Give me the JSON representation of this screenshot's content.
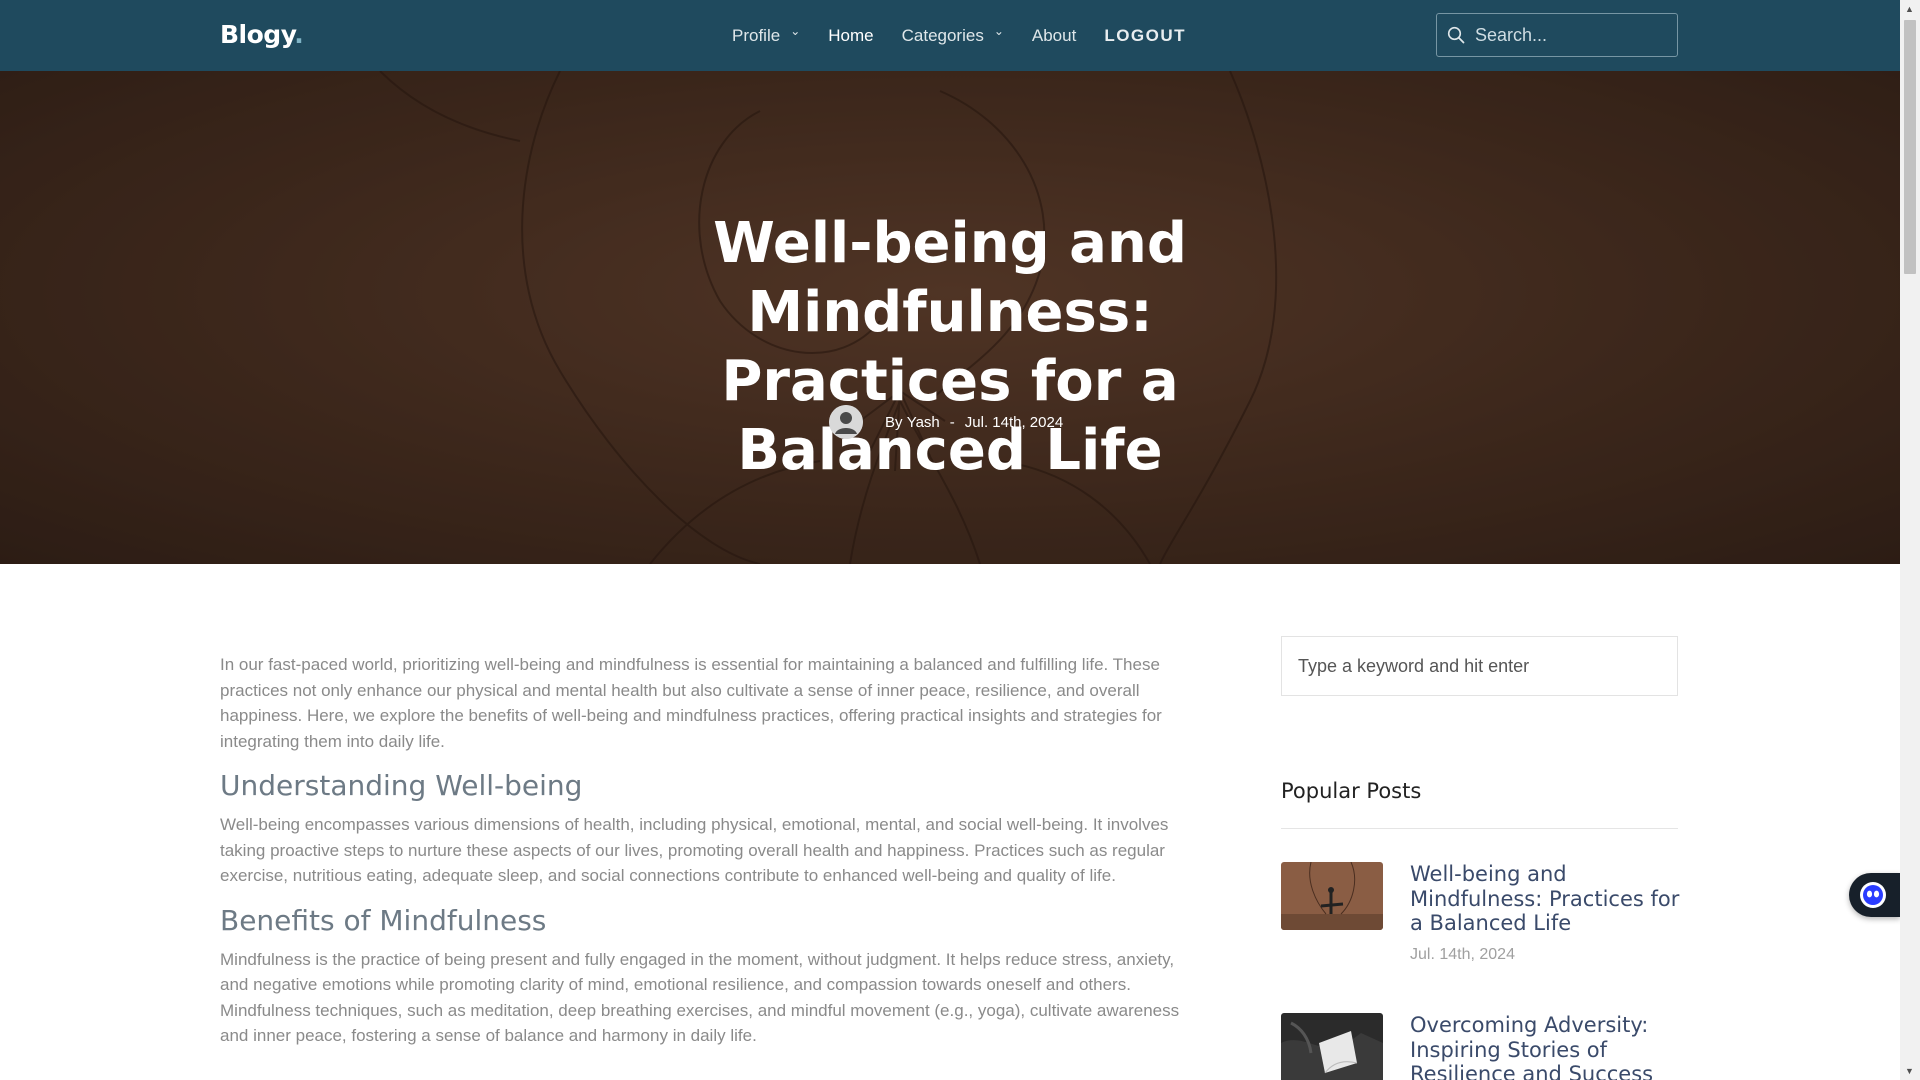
{
  "nav": {
    "brand": "Blogy",
    "brand_dot": ".",
    "items": [
      {
        "label": "Profile",
        "has_dropdown": true
      },
      {
        "label": "Home",
        "active": true
      },
      {
        "label": "Categories",
        "has_dropdown": true
      },
      {
        "label": "About"
      },
      {
        "label": "LOGOUT"
      }
    ],
    "search_placeholder": "Search...",
    "search_icon": "search-icon",
    "dropdown_icon": "chevron-down-icon"
  },
  "hero": {
    "title": "Well-being and Mindfulness: Practices for a Balanced Life",
    "author_prefix": "By",
    "author": "Yash",
    "separator": "-",
    "date": "Jul. 14th, 2024",
    "avatar_icon": "user-avatar-icon"
  },
  "article": {
    "intro": "In our fast-paced world, prioritizing well-being and mindfulness is essential for maintaining a balanced and fulfilling life. These practices not only enhance our physical and mental health but also cultivate a sense of inner peace, resilience, and overall happiness. Here, we explore the benefits of well-being and mindfulness practices, offering practical insights and strategies for integrating them into daily life.",
    "sections": [
      {
        "heading": "Understanding Well-being",
        "body": "Well-being encompasses various dimensions of health, including physical, emotional, mental, and social well-being. It involves taking proactive steps to nurture these aspects of our lives, promoting overall health and happiness. Practices such as regular exercise, nutritious eating, adequate sleep, and social connections contribute to enhanced well-being and quality of life."
      },
      {
        "heading": "Benefits of Mindfulness",
        "body": "Mindfulness is the practice of being present and fully engaged in the moment, without judgment. It helps reduce stress, anxiety, and negative emotions while promoting clarity of mind, emotional resilience, and compassion towards oneself and others. Mindfulness techniques, such as meditation, deep breathing exercises, and mindful movement (e.g., yoga), cultivate awareness and inner peace, fostering a sense of balance and harmony in daily life."
      }
    ]
  },
  "sidebar": {
    "search_placeholder": "Type a keyword and hit enter",
    "popular_title": "Popular Posts",
    "posts": [
      {
        "title": "Well-being and Mindfulness: Practices for a Balanced Life",
        "date": "Jul. 14th, 2024"
      },
      {
        "title": "Overcoming Adversity: Inspiring Stories of Resilience and Success",
        "date": ""
      }
    ]
  },
  "widget": {
    "icon": "chat-bot-icon"
  },
  "colors": {
    "navbar": "#1f4a5e",
    "hero_brown": "#4d3324",
    "heading_gray": "#6d7a85",
    "body_gray": "#8a8a8a",
    "post_title": "#3a4a6a"
  }
}
